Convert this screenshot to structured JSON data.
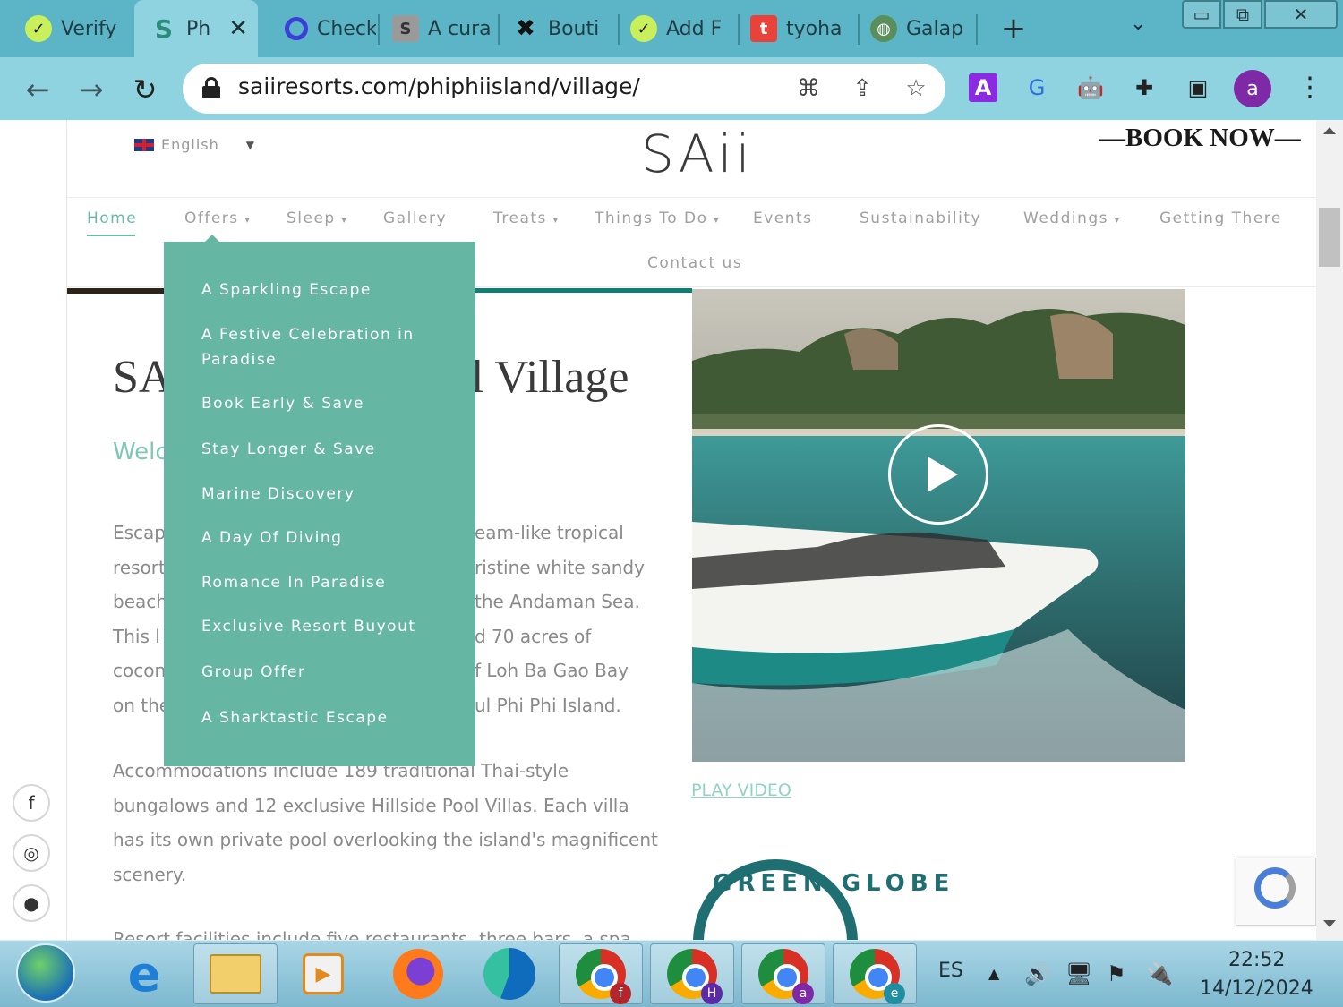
{
  "browser": {
    "tabs": [
      {
        "title": "Verify",
        "favicon": "check-circle-icon",
        "active": false
      },
      {
        "title": "Ph",
        "favicon": "S",
        "active": true
      },
      {
        "title": "Check",
        "favicon": "ring-icon",
        "active": false
      },
      {
        "title": "A cura",
        "favicon": "S",
        "active": false
      },
      {
        "title": "Bouti",
        "favicon": "x-icon",
        "active": false
      },
      {
        "title": "Add F",
        "favicon": "check-circle-icon",
        "active": false
      },
      {
        "title": "tyoha",
        "favicon": "t",
        "active": false
      },
      {
        "title": "Galap",
        "favicon": "globe-icon",
        "active": false
      }
    ],
    "url": "saiiresorts.com/phiphiisland/village/",
    "profile_initial": "a"
  },
  "site": {
    "language": "English",
    "logo": "SAii",
    "book_now": "—BOOK NOW—",
    "nav": [
      "Home",
      "Offers",
      "Sleep",
      "Gallery",
      "Treats",
      "Things To Do",
      "Events",
      "Sustainability",
      "Weddings",
      "Getting There",
      "Contact us"
    ],
    "nav_active": "Home"
  },
  "offers_menu": [
    "A Sparkling Escape",
    "A Festive Celebration in Paradise",
    "Book Early & Save",
    "Stay Longer & Save",
    "Marine Discovery",
    "A Day Of Diving",
    "Romance In Paradise",
    "Exclusive Resort Buyout",
    "Group Offer",
    "A Sharktastic Escape"
  ],
  "content": {
    "title_left": "SA",
    "title_right": "l Village",
    "welcome": "Welc",
    "para1_left": [
      "Escap",
      "resort",
      "beach",
      "This l",
      "cocon",
      "on the"
    ],
    "para1_right": [
      "eam-like tropical",
      "ristine white sandy",
      "the Andaman Sea.",
      "d 70 acres of",
      "f Loh Ba Gao Bay",
      "ul Phi Phi Island."
    ],
    "para2": [
      "Accommodations include 189 traditional Thai-style",
      "bungalows and 12 exclusive Hillside Pool Villas. Each villa",
      "has its own private pool overlooking the island's magnificent",
      "scenery."
    ],
    "para3": "Resort facilities include five restaurants, three bars, a spa,",
    "play_video": "PLAY VIDEO",
    "badge_text": "GREEN GLOBE"
  },
  "taskbar": {
    "language": "ES",
    "time": "22:52",
    "date": "14/12/2024",
    "chrome_profiles": [
      "f",
      "H",
      "a",
      "e"
    ]
  },
  "colors": {
    "accent": "#66b6a4",
    "chrome_frame": "#5cb5c6",
    "toolbar": "#8fd3e0"
  }
}
